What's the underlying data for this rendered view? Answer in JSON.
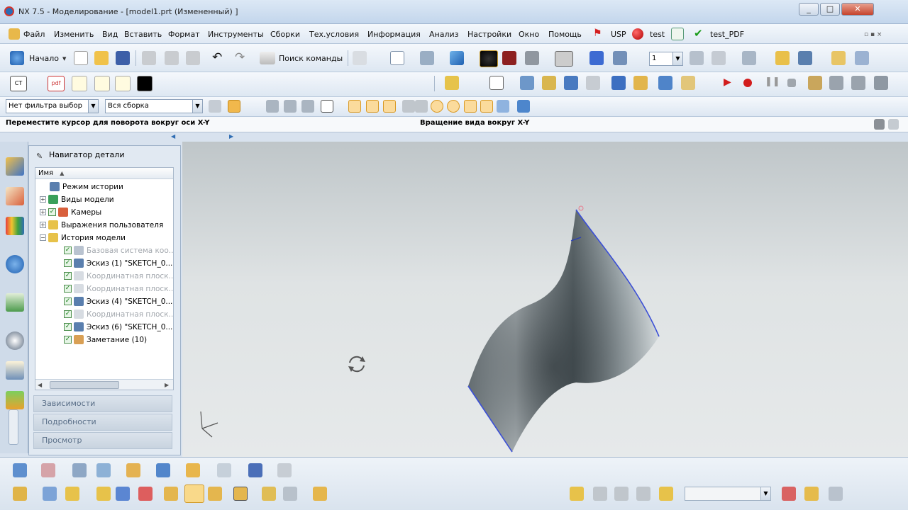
{
  "window": {
    "title": "NX 7.5 - Моделирование - [model1.prt (Измененный) ]",
    "controls": [
      "_",
      "□",
      "✕"
    ]
  },
  "menubar": {
    "items": [
      "Файл",
      "Изменить",
      "Вид",
      "Вставить",
      "Формат",
      "Инструменты",
      "Сборки",
      "Тех.условия",
      "Информация",
      "Анализ",
      "Настройки",
      "Окно",
      "Помощь",
      "USP",
      "test",
      "test_PDF"
    ]
  },
  "toolbar": {
    "start_label": "Начало",
    "search_label": "Поиск команды",
    "layer_value": "1",
    "filter_value": "Нет фильтра выбор",
    "scope_value": "Вся сборка"
  },
  "statusbar": {
    "prompt": "Переместите курсор для поворота вокруг оси X-Y",
    "status": "Вращение вида вокруг X-Y"
  },
  "navigator": {
    "title": "Навигатор детали",
    "column_header": "Имя",
    "items": [
      {
        "label": "Режим истории",
        "dim": false
      },
      {
        "label": "Виды модели",
        "dim": false
      },
      {
        "label": "Камеры",
        "dim": false
      },
      {
        "label": "Выражения пользователя",
        "dim": false
      },
      {
        "label": "История модели",
        "dim": false
      },
      {
        "label": "Базовая система коо...",
        "dim": true
      },
      {
        "label": "Эскиз (1) \"SKETCH_0...",
        "dim": false
      },
      {
        "label": "Координатная плоск...",
        "dim": true
      },
      {
        "label": "Координатная плоск...",
        "dim": true
      },
      {
        "label": "Эскиз (4) \"SKETCH_0...",
        "dim": false
      },
      {
        "label": "Координатная плоск...",
        "dim": true
      },
      {
        "label": "Эскиз (6) \"SKETCH_0...",
        "dim": false
      },
      {
        "label": "Заметание (10)",
        "dim": false
      }
    ],
    "panels": [
      "Зависимости",
      "Подробности",
      "Просмотр"
    ]
  },
  "colors": {
    "accent": "#2f6db3",
    "menu_flag": "#d41f1f",
    "check_green": "#1a9b1a",
    "surface_edge": "#3b4fd6"
  }
}
